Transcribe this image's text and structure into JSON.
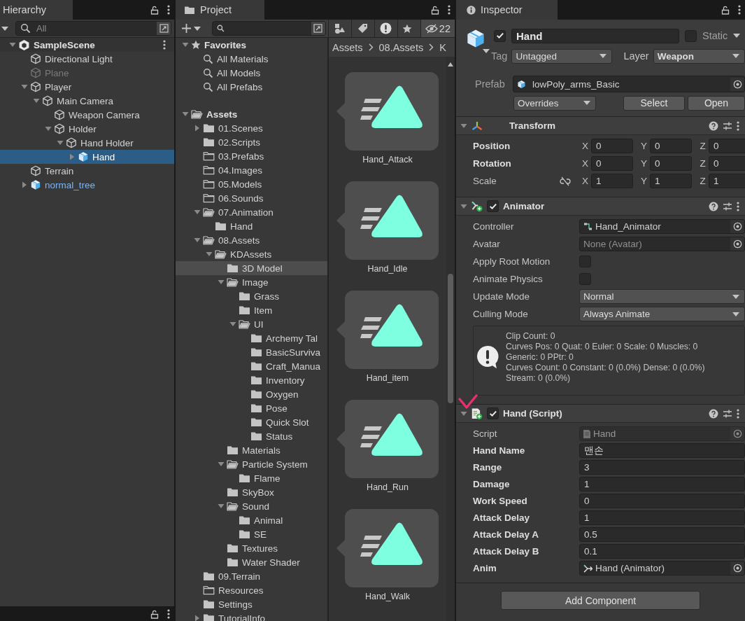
{
  "hierarchy": {
    "title": "Hierarchy",
    "search": {
      "placeholder": "All"
    },
    "scene": {
      "name": "SampleScene",
      "expanded": true
    },
    "items": [
      {
        "label": "Directional Light",
        "kind": "object",
        "active": true,
        "selected": false
      },
      {
        "label": "Plane",
        "kind": "object",
        "active": false,
        "selected": false
      },
      {
        "label": "Player",
        "kind": "object",
        "active": true,
        "selected": false,
        "expanded": true,
        "children": [
          {
            "label": "Main Camera",
            "kind": "object",
            "active": true,
            "selected": false,
            "expanded": true,
            "children": [
              {
                "label": "Weapon Camera",
                "kind": "object",
                "active": true,
                "selected": false
              },
              {
                "label": "Holder",
                "kind": "object",
                "active": true,
                "selected": false,
                "expanded": true,
                "children": [
                  {
                    "label": "Hand Holder",
                    "kind": "object",
                    "active": true,
                    "selected": false,
                    "expanded": true,
                    "children": [
                      {
                        "label": "Hand",
                        "kind": "prefab",
                        "active": true,
                        "selected": true,
                        "expanded": false
                      }
                    ]
                  }
                ]
              }
            ]
          }
        ]
      },
      {
        "label": "Terrain",
        "kind": "object",
        "active": true,
        "selected": false
      },
      {
        "label": "normal_tree",
        "kind": "prefab",
        "active": true,
        "selected": false,
        "expanded": false
      }
    ]
  },
  "project": {
    "title": "Project",
    "hidden_filter": {
      "on": true,
      "count": "22"
    },
    "favorites": {
      "label": "Favorites",
      "expanded": true,
      "items": [
        {
          "label": "All Materials",
          "selected": false
        },
        {
          "label": "All Models",
          "selected": false
        },
        {
          "label": "All Prefabs",
          "selected": false
        }
      ]
    },
    "assets": {
      "label": "Assets",
      "empty": false,
      "expanded": true,
      "selected": false,
      "children": [
        {
          "label": "01.Scenes",
          "empty": false,
          "expanded": false,
          "selected": false
        },
        {
          "label": "02.Scripts",
          "empty": false,
          "selected": false
        },
        {
          "label": "03.Prefabs",
          "empty": true,
          "selected": false
        },
        {
          "label": "04.Images",
          "empty": true,
          "selected": false
        },
        {
          "label": "05.Models",
          "empty": true,
          "selected": false
        },
        {
          "label": "06.Sounds",
          "empty": true,
          "selected": false
        },
        {
          "label": "07.Animation",
          "empty": false,
          "expanded": true,
          "selected": false,
          "children": [
            {
              "label": "Hand",
              "empty": false,
              "selected": false
            }
          ]
        },
        {
          "label": "08.Assets",
          "empty": false,
          "expanded": true,
          "selected": false,
          "children": [
            {
              "label": "KDAssets",
              "empty": false,
              "expanded": true,
              "selected": false,
              "children": [
                {
                  "label": "3D Model",
                  "empty": false,
                  "selected": true
                },
                {
                  "label": "Image",
                  "empty": false,
                  "expanded": true,
                  "selected": false,
                  "children": [
                    {
                      "label": "Grass",
                      "empty": false,
                      "selected": false
                    },
                    {
                      "label": "Item",
                      "empty": false,
                      "selected": false
                    },
                    {
                      "label": "UI",
                      "empty": false,
                      "expanded": true,
                      "selected": false,
                      "children": [
                        {
                          "label": "Archemy Tal",
                          "empty": false,
                          "selected": false
                        },
                        {
                          "label": "BasicSurviva",
                          "empty": false,
                          "selected": false
                        },
                        {
                          "label": "Craft_Manua",
                          "empty": false,
                          "selected": false
                        },
                        {
                          "label": "Inventory",
                          "empty": false,
                          "selected": false
                        },
                        {
                          "label": "Oxygen",
                          "empty": false,
                          "selected": false
                        },
                        {
                          "label": "Pose",
                          "empty": false,
                          "selected": false
                        },
                        {
                          "label": "Quick Slot",
                          "empty": false,
                          "selected": false
                        },
                        {
                          "label": "Status",
                          "empty": false,
                          "selected": false
                        }
                      ]
                    }
                  ]
                },
                {
                  "label": "Materials",
                  "empty": false,
                  "selected": false
                },
                {
                  "label": "Particle System",
                  "empty": false,
                  "expanded": true,
                  "selected": false,
                  "children": [
                    {
                      "label": "Flame",
                      "empty": false,
                      "selected": false
                    }
                  ]
                },
                {
                  "label": "SkyBox",
                  "empty": false,
                  "selected": false
                },
                {
                  "label": "Sound",
                  "empty": false,
                  "expanded": true,
                  "selected": false,
                  "children": [
                    {
                      "label": "Animal",
                      "empty": false,
                      "selected": false
                    },
                    {
                      "label": "SE",
                      "empty": false,
                      "selected": false
                    }
                  ]
                },
                {
                  "label": "Textures",
                  "empty": false,
                  "selected": false
                },
                {
                  "label": "Water Shader",
                  "empty": false,
                  "selected": false
                }
              ]
            }
          ]
        },
        {
          "label": "09.Terrain",
          "empty": false,
          "selected": false
        },
        {
          "label": "Resources",
          "empty": true,
          "selected": false
        },
        {
          "label": "Settings",
          "empty": false,
          "selected": false
        },
        {
          "label": "TutorialInfo",
          "empty": false,
          "expanded": false,
          "selected": false
        }
      ]
    },
    "breadcrumb": [
      "Assets",
      "08.Assets",
      "K"
    ],
    "grid_items": [
      {
        "label": "Hand_Attack"
      },
      {
        "label": "Hand_Idle"
      },
      {
        "label": "Hand_item"
      },
      {
        "label": "Hand_Run"
      },
      {
        "label": "Hand_Walk"
      }
    ]
  },
  "inspector": {
    "title": "Inspector",
    "object": {
      "name": "Hand",
      "active": true,
      "static": false,
      "static_label": "Static",
      "tag_label": "Tag",
      "tag": "Untagged",
      "layer_label": "Layer",
      "layer": "Weapon",
      "prefab_label": "Prefab",
      "prefab": "lowPoly_arms_Basic",
      "overrides": "Overrides",
      "buttons": [
        "Select",
        "Open"
      ]
    },
    "components": [
      {
        "kind": "transform",
        "title": "Transform",
        "expanded": true,
        "added": false,
        "rows": [
          {
            "label": "Position",
            "overridden": true,
            "fields": [
              {
                "axis": "X",
                "value": "0"
              },
              {
                "axis": "Y",
                "value": "0"
              },
              {
                "axis": "Z",
                "value": "0"
              }
            ]
          },
          {
            "label": "Rotation",
            "overridden": true,
            "fields": [
              {
                "axis": "X",
                "value": "0"
              },
              {
                "axis": "Y",
                "value": "0"
              },
              {
                "axis": "Z",
                "value": "0"
              }
            ]
          },
          {
            "label": "Scale",
            "overridden": false,
            "proportional": false,
            "fields": [
              {
                "axis": "X",
                "value": "1"
              },
              {
                "axis": "Y",
                "value": "1"
              },
              {
                "axis": "Z",
                "value": "1"
              }
            ]
          }
        ]
      },
      {
        "kind": "animator",
        "title": "Animator",
        "expanded": true,
        "added": true,
        "enabled": true,
        "rows": [
          {
            "kind": "asset",
            "label": "Controller",
            "overridden": false,
            "value": "Hand_Animator"
          },
          {
            "kind": "asset",
            "label": "Avatar",
            "overridden": false,
            "placeholder": "None (Avatar)"
          },
          {
            "kind": "checkbox",
            "label": "Apply Root Motion",
            "overridden": false,
            "checked": false
          },
          {
            "kind": "checkbox",
            "label": "Animate Physics",
            "overridden": false,
            "checked": false
          },
          {
            "kind": "dropdown",
            "label": "Update Mode",
            "overridden": false,
            "value": "Normal"
          },
          {
            "kind": "dropdown",
            "label": "Culling Mode",
            "overridden": false,
            "value": "Always Animate"
          }
        ],
        "info": [
          "Clip Count: 0",
          "Curves Pos: 0 Quat: 0 Euler: 0 Scale: 0 Muscles: 0",
          "Generic: 0 PPtr: 0",
          "Curves Count: 0 Constant: 0 (0.0%) Dense: 0 (0.0%)",
          "Stream: 0 (0.0%)"
        ]
      },
      {
        "kind": "script",
        "title": "Hand (Script)",
        "expanded": true,
        "added": true,
        "enabled": true,
        "rows": [
          {
            "kind": "script",
            "label": "Script",
            "overridden": false,
            "value": "Hand",
            "disabled": true
          },
          {
            "kind": "text",
            "label": "Hand Name",
            "overridden": true,
            "value": "맨손"
          },
          {
            "kind": "text",
            "label": "Range",
            "overridden": true,
            "value": "3"
          },
          {
            "kind": "text",
            "label": "Damage",
            "overridden": true,
            "value": "1"
          },
          {
            "kind": "text",
            "label": "Work Speed",
            "overridden": true,
            "value": "0"
          },
          {
            "kind": "text",
            "label": "Attack Delay",
            "overridden": true,
            "value": "1"
          },
          {
            "kind": "text",
            "label": "Attack Delay A",
            "overridden": true,
            "value": "0.5"
          },
          {
            "kind": "text",
            "label": "Attack Delay B",
            "overridden": true,
            "value": "0.1"
          },
          {
            "kind": "component",
            "label": "Anim",
            "overridden": true,
            "value": "Hand (Animator)"
          }
        ]
      }
    ],
    "add_component": "Add Component"
  }
}
